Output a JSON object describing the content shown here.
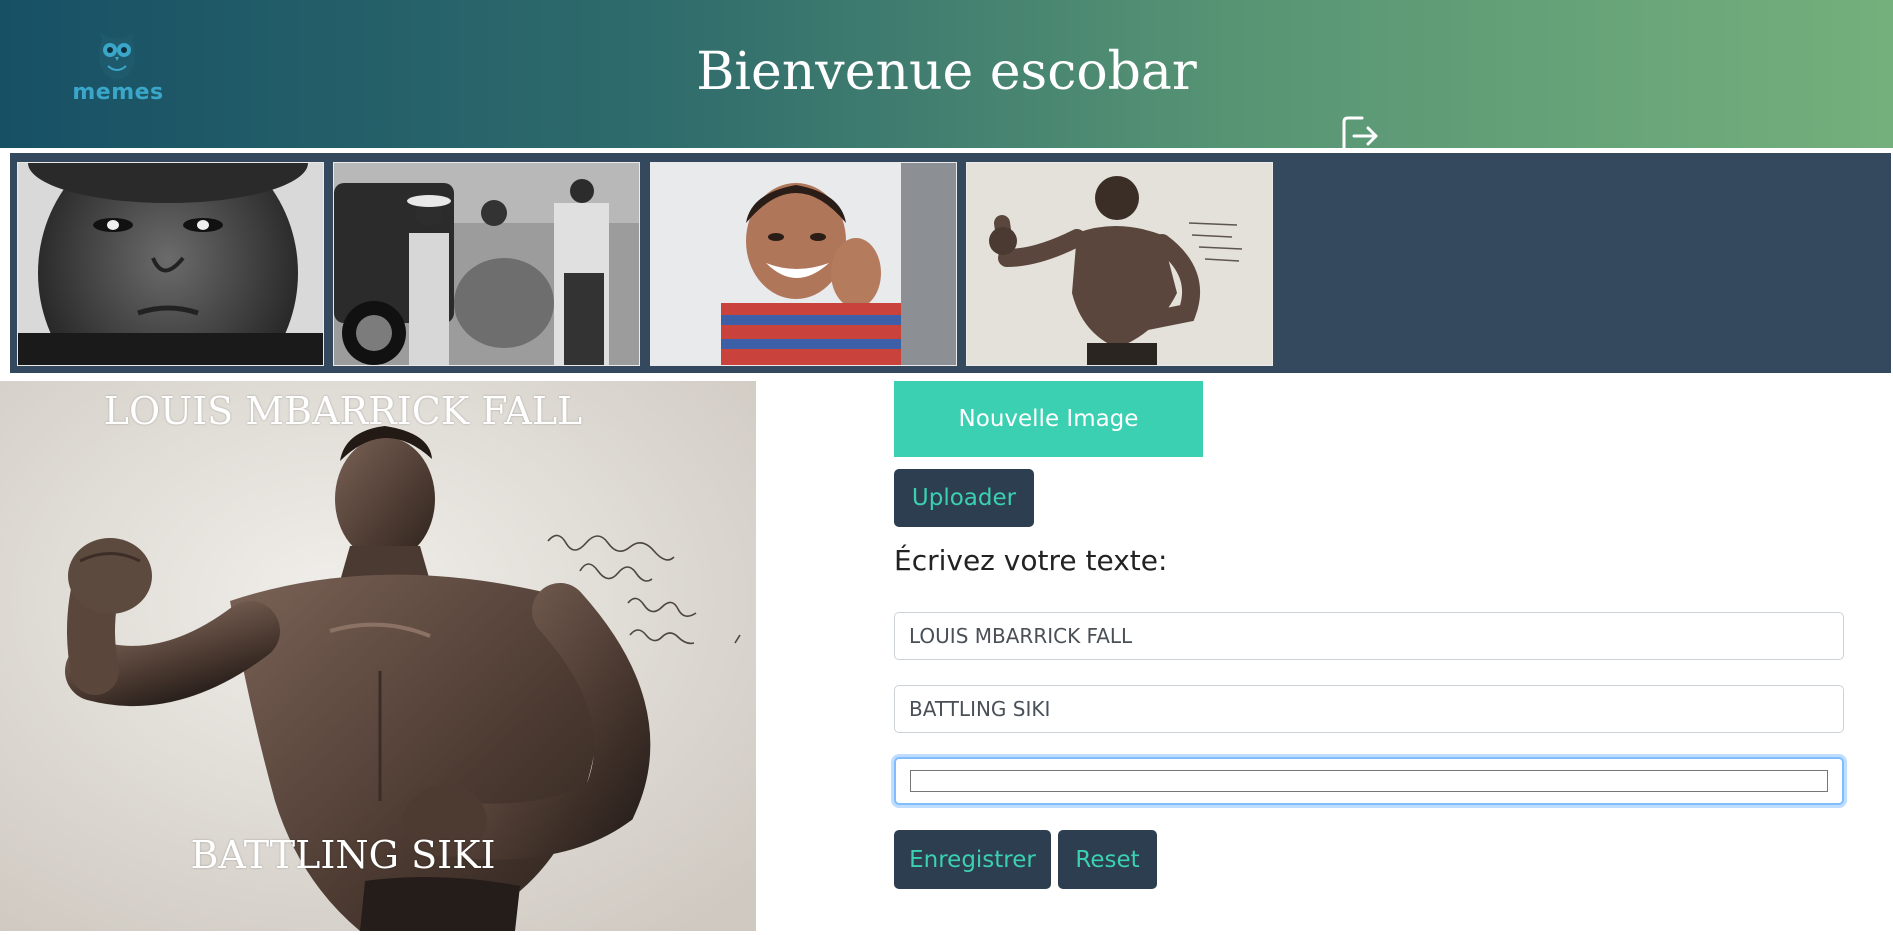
{
  "header": {
    "logo_text": "memes",
    "title": "Bienvenue escobar",
    "logout_icon": "logout-icon"
  },
  "gallery": {
    "thumbnails": [
      {
        "icon": "portrait-boy-bw-image"
      },
      {
        "icon": "family-car-bw-image"
      },
      {
        "icon": "smiling-child-image"
      },
      {
        "icon": "boxer-sepia-image"
      }
    ]
  },
  "preview": {
    "top_text": "LOUIS MBARRICK FALL",
    "bottom_text": "BATTLING SIKI"
  },
  "editor": {
    "new_image_label": "Nouvelle Image",
    "upload_label": "Uploader",
    "prompt_label": "Écrivez votre texte:",
    "field_1_value": "LOUIS MBARRICK FALL",
    "field_2_value": "BATTLING SIKI",
    "save_label": "Enregistrer",
    "reset_label": "Reset"
  },
  "colors": {
    "header_start": "#175065",
    "header_end": "#74b07c",
    "gallery_bg": "#34495e",
    "accent": "#3bd0b1",
    "dark_button": "#2c3e50"
  }
}
